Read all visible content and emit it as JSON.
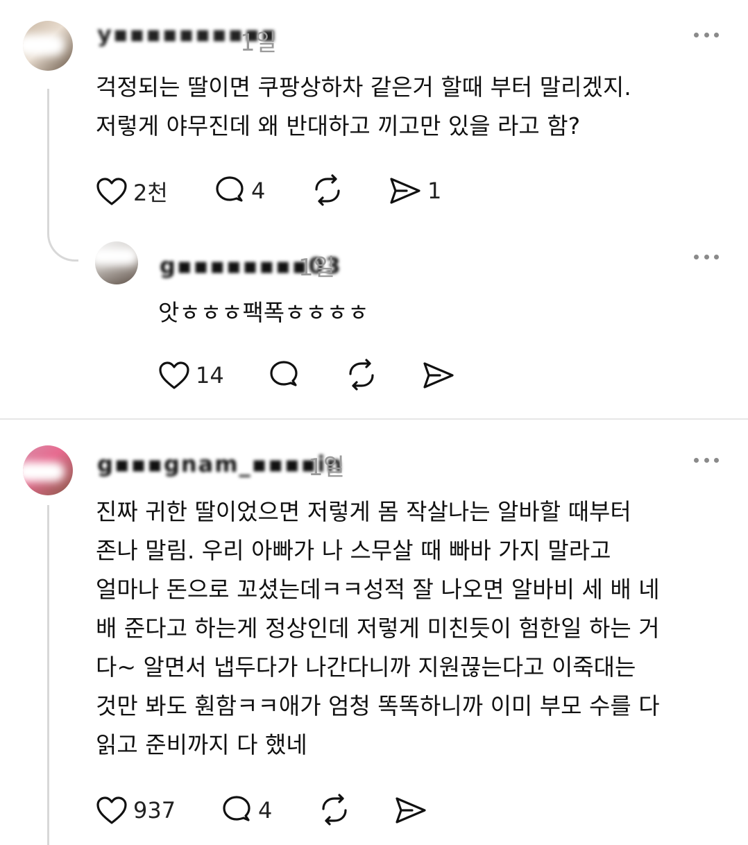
{
  "comments": [
    {
      "username": "y▪▪▪▪▪▪▪▪▪▪",
      "time": "1일",
      "text_lines": [
        "걱정되는 딸이면 쿠팡상하차 같은거 할때 부터 말리겠지.",
        "저렇게 야무진데 왜 반대하고 끼고만 있을 라고 함?"
      ],
      "likes": "2천",
      "replies": "4",
      "reposts": "",
      "shares": "1"
    },
    {
      "username": "g▪▪▪▪▪▪▪▪03",
      "time": "1일",
      "text_lines": [
        "앗ㅎㅎㅎ팩폭ㅎㅎㅎㅎ"
      ],
      "likes": "14",
      "replies": "",
      "reposts": "",
      "shares": ""
    },
    {
      "username": "g▪▪▪gnam_▪▪▪▪in",
      "time": "1일",
      "text_lines": [
        "진짜 귀한 딸이었으면 저렇게 몸 작살나는 알바할 때부터",
        "존나 말림. 우리 아빠가 나 스무살 때 빠바 가지 말라고",
        "얼마나 돈으로 꼬셨는데ㅋㅋ성적 잘 나오면 알바비 세 배 네",
        "배 준다고 하는게 정상인데 저렇게 미친듯이 험한일 하는 거",
        "다~ 알면서 냅두다가 나간다니까 지원끊는다고 이죽대는",
        "것만 봐도 훤함ㅋㅋ애가 엄청 똑똑하니까 이미 부모 수를 다",
        "읽고 준비까지 다 했네"
      ],
      "likes": "937",
      "replies": "4",
      "reposts": "",
      "shares": ""
    }
  ],
  "icons": {
    "like": "heart-icon",
    "reply": "comment-icon",
    "repost": "repost-icon",
    "share": "send-icon",
    "more": "more-icon"
  },
  "colors": {
    "text": "#111111",
    "muted": "#9a9a9a",
    "line": "#d8d8d8"
  }
}
